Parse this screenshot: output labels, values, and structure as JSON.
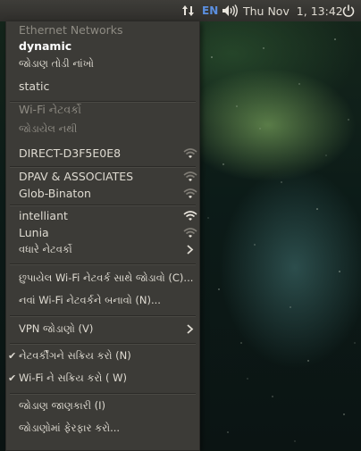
{
  "panel": {
    "keyboard_layout": "EN",
    "clock": "Thu Nov  1, 13:42",
    "icons": [
      "network-updown-icon",
      "volume-icon",
      "power-icon"
    ]
  },
  "menu": {
    "ethernet_header": "Ethernet Networks",
    "ethernet_connection": "dynamic",
    "disconnect": "જોડાણ તોડી નાંખો",
    "static": "static",
    "wifi_header": "Wi-Fi નેટવર્કો",
    "not_connected": "જોડાયેલ નથી",
    "networks": [
      {
        "name": "DIRECT-D3F5E0E8",
        "icon": "wifi-signal-weak-icon",
        "signal": 1
      },
      {
        "name": "DPAV & ASSOCIATES",
        "icon": "wifi-signal-weak-icon",
        "signal": 1
      },
      {
        "name": "Glob-Binaton",
        "icon": "wifi-signal-weak-icon",
        "signal": 1
      },
      {
        "name": "intelliant",
        "icon": "wifi-signal-good-icon",
        "signal": 3
      },
      {
        "name": "Lunia",
        "icon": "wifi-signal-weak-icon",
        "signal": 1
      }
    ],
    "more_networks": "વધારે નેટવર્કો",
    "connect_hidden": "છુપાયેલ Wi-Fi નેટવર્ક સાથે જોડાવો (C)...",
    "create_new": "નવાં Wi-Fi નેટવર્કને બનાવો (N)...",
    "vpn": "VPN જોડાણો (V)",
    "enable_networking": "નેટવર્કીંગને સક્રિય કરો (N)",
    "enable_wifi": "Wi-Fi ને સક્રિય કરો ( W)",
    "connection_info": "જોડાણ જાણકારી (I)",
    "edit_connections": "જોડાણોમાં ફેરફાર કરો...",
    "checkmark": "✔"
  }
}
